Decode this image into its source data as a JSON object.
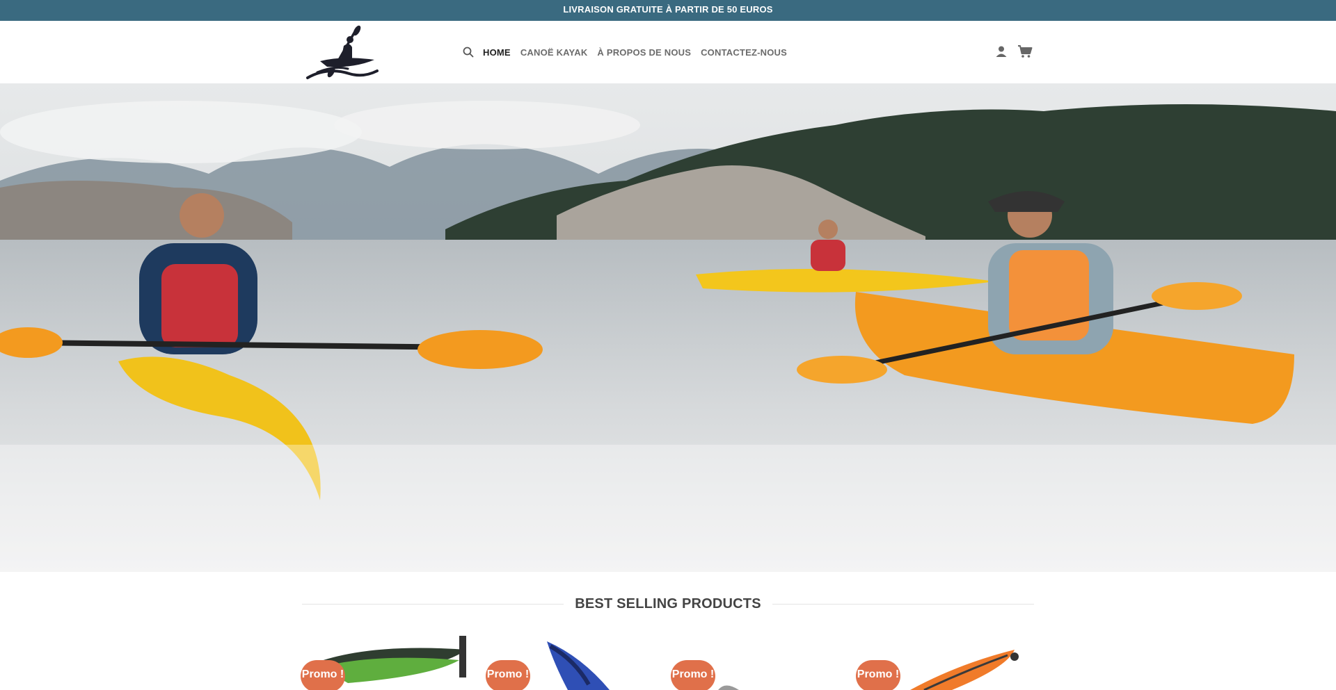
{
  "topbar": {
    "text": "LIVRAISON GRATUITE À PARTIR DE 50 EUROS"
  },
  "header": {
    "logo_icon": "kayaker-logo-icon",
    "nav": [
      {
        "label": "HOME",
        "active": true
      },
      {
        "label": "CANOË KAYAK",
        "active": false
      },
      {
        "label": "À PROPOS DE NOUS",
        "active": false
      },
      {
        "label": "CONTACTEZ-NOUS",
        "active": false
      }
    ],
    "icons": [
      "search-icon",
      "user-icon",
      "cart-icon"
    ]
  },
  "hero": {
    "image": "kayakers-on-lake-photo"
  },
  "section": {
    "title": "BEST SELLING PRODUCTS"
  },
  "products": [
    {
      "badge": "Promo !",
      "image": "inflatable-kayak-green"
    },
    {
      "badge": "Promo !",
      "image": "inflatable-kayak-blue"
    },
    {
      "badge": "Promo !",
      "image": "kayak-grey"
    },
    {
      "badge": "Promo !",
      "image": "inflatable-kayak-orange"
    }
  ],
  "colors": {
    "topbar": "#3a6a80",
    "promo": "#e0704a",
    "text_dark": "#1f1f1f",
    "text_nav": "#6b6b6b"
  }
}
